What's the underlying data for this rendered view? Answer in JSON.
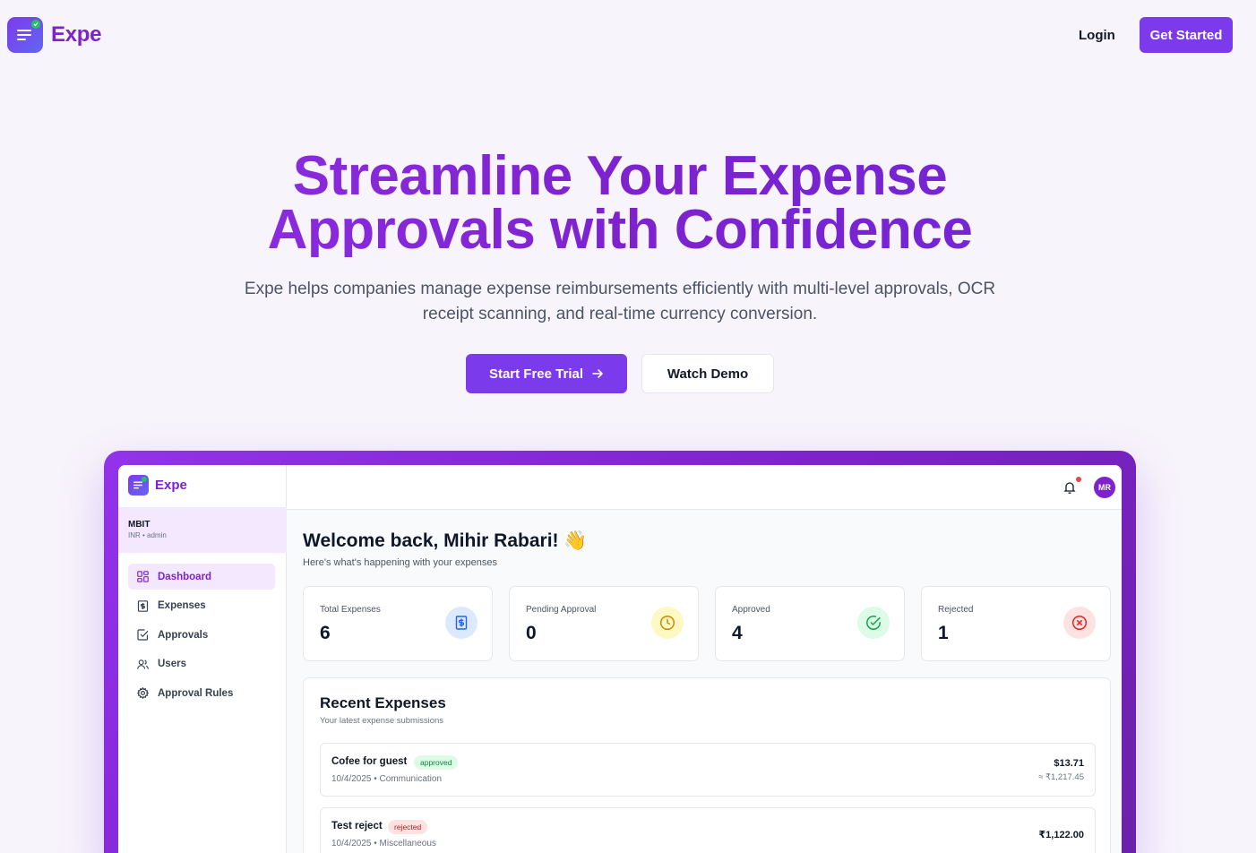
{
  "nav": {
    "brand": "Expe",
    "login": "Login",
    "get_started": "Get Started"
  },
  "hero": {
    "title_line1": "Streamline Your Expense",
    "title_line2": "Approvals with Confidence",
    "subtitle_line1": "Expe helps companies manage expense reimbursements efficiently with multi-level approvals, OCR",
    "subtitle_line2": "receipt scanning, and real-time currency conversion.",
    "primary_cta": "Start Free Trial",
    "secondary_cta": "Watch Demo"
  },
  "app": {
    "brand": "Expe",
    "org": {
      "name": "MBIT",
      "meta": "INR • admin"
    },
    "sidebar": {
      "items": [
        {
          "label": "Dashboard",
          "icon": "dashboard-icon",
          "active": true
        },
        {
          "label": "Expenses",
          "icon": "receipt-icon",
          "active": false
        },
        {
          "label": "Approvals",
          "icon": "check-square-icon",
          "active": false
        },
        {
          "label": "Users",
          "icon": "users-icon",
          "active": false
        },
        {
          "label": "Approval Rules",
          "icon": "gear-icon",
          "active": false
        }
      ]
    },
    "topbar": {
      "avatar_initials": "MR",
      "has_notification": true
    },
    "welcome": {
      "title": "Welcome back, Mihir Rabari! 👋",
      "subtitle": "Here's what's happening with your expenses"
    },
    "stats": [
      {
        "label": "Total Expenses",
        "value": "6",
        "icon": "dollar-receipt-icon",
        "color": "#2563eb",
        "bg": "#dbeafe"
      },
      {
        "label": "Pending Approval",
        "value": "0",
        "icon": "clock-icon",
        "color": "#ca8a04",
        "bg": "#fef9c3"
      },
      {
        "label": "Approved",
        "value": "4",
        "icon": "check-circle-icon",
        "color": "#16a34a",
        "bg": "#dcfce7"
      },
      {
        "label": "Rejected",
        "value": "1",
        "icon": "x-circle-icon",
        "color": "#dc2626",
        "bg": "#fee2e2"
      }
    ],
    "recent": {
      "title": "Recent Expenses",
      "subtitle": "Your latest expense submissions",
      "rows": [
        {
          "name": "Cofee for guest",
          "status": "approved",
          "meta": "10/4/2025 • Communication",
          "amount": "$13.71",
          "converted": "≈ ₹1,217.45"
        },
        {
          "name": "Test reject",
          "status": "rejected",
          "meta": "10/4/2025 • Miscellaneous",
          "amount": "₹1,122.00",
          "converted": ""
        }
      ]
    }
  },
  "colors": {
    "brand": "#7c3aed",
    "brand_text": "#7e22ce",
    "background": "#f8f4fb"
  }
}
